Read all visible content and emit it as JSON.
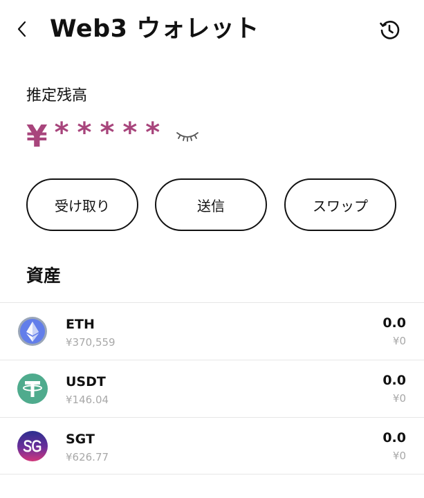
{
  "header": {
    "title": "Web3 ウォレット",
    "back_icon": "chevron-left-icon",
    "history_icon": "history-clock-icon"
  },
  "balance": {
    "label": "推定残高",
    "currency_symbol": "¥",
    "masked_value": "*****",
    "visibility_icon": "eye-closed-icon",
    "accent_color": "#a8457c"
  },
  "actions": {
    "receive_label": "受け取り",
    "send_label": "送信",
    "swap_label": "スワップ"
  },
  "assets": {
    "title": "資産",
    "items": [
      {
        "symbol": "ETH",
        "price": "¥370,559",
        "amount": "0.0",
        "value": "¥0",
        "icon": "eth-icon",
        "icon_color": "#627eea"
      },
      {
        "symbol": "USDT",
        "price": "¥146.04",
        "amount": "0.0",
        "value": "¥0",
        "icon": "usdt-icon",
        "icon_color": "#4fab8d"
      },
      {
        "symbol": "SGT",
        "price": "¥626.77",
        "amount": "0.0",
        "value": "¥0",
        "icon": "sgt-icon",
        "icon_color": "#6d2f9a"
      }
    ]
  }
}
